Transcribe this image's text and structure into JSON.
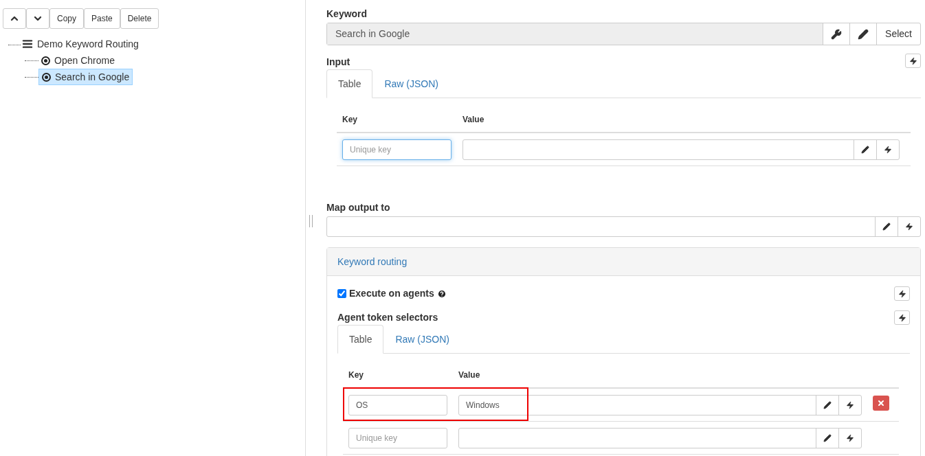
{
  "toolbar": [
    {
      "kind": "up"
    },
    {
      "kind": "down"
    },
    {
      "kind": "text",
      "label": "Copy"
    },
    {
      "kind": "text",
      "label": "Paste"
    },
    {
      "kind": "text",
      "label": "Delete"
    }
  ],
  "tree": {
    "label": "Demo Keyword Routing",
    "selected": false,
    "children": [
      {
        "label": "Open Chrome",
        "selected": false
      },
      {
        "label": "Search in Google",
        "selected": true
      }
    ]
  },
  "keyword": {
    "label": "Keyword",
    "value": "Search in Google",
    "select_label": "Select"
  },
  "input": {
    "label": "Input",
    "tabs": [
      {
        "label": "Table",
        "selected": true
      },
      {
        "label": "Raw (JSON)",
        "selected": false
      }
    ],
    "columns": [
      "Key",
      "Value"
    ],
    "rows": [
      {
        "key_placeholder": "Unique key",
        "focused": true,
        "highlighted": false,
        "removable": false
      }
    ]
  },
  "map_output": {
    "label": "Map output to"
  },
  "routing": {
    "title": "Keyword routing",
    "execute": {
      "label": "Execute on agents",
      "checked": true
    },
    "selectors": {
      "label": "Agent token selectors",
      "tabs": [
        {
          "label": "Table",
          "selected": true
        },
        {
          "label": "Raw (JSON)",
          "selected": false
        }
      ],
      "columns": [
        "Key",
        "Value"
      ],
      "rows": [
        {
          "key": "OS",
          "value": "Windows",
          "focused": false,
          "highlighted": true,
          "removable": true
        },
        {
          "key_placeholder": "Unique key",
          "focused": false,
          "highlighted": false,
          "removable": false
        }
      ]
    }
  }
}
